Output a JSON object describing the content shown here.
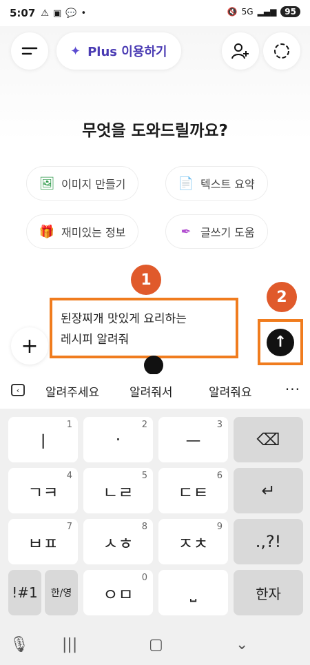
{
  "status": {
    "time": "5:07",
    "icons_left": [
      "warning-icon",
      "image-icon",
      "talk-icon",
      "dot-icon"
    ],
    "signal": "5G",
    "battery": "95"
  },
  "header": {
    "plus_label": "Plus 이용하기"
  },
  "main": {
    "headline": "무엇을 도와드릴까요?",
    "chips": [
      {
        "label": "이미지 만들기",
        "icon": "image-create-icon",
        "color": "#2e9a4a"
      },
      {
        "label": "텍스트 요약",
        "icon": "document-icon",
        "color": "#e8832a"
      },
      {
        "label": "재미있는 정보",
        "icon": "gift-icon",
        "color": "#3aa7c9"
      },
      {
        "label": "글쓰기 도움",
        "icon": "pen-icon",
        "color": "#b24fd0"
      }
    ]
  },
  "annotations": {
    "badge1": "1",
    "badge2": "2"
  },
  "composer": {
    "text_line1": "된장찌개 맛있게 요리하는",
    "text_line2": "레시피 알려줘"
  },
  "suggestions": {
    "words": [
      "알려주세요",
      "알려줘서",
      "알려줘요"
    ],
    "more": "···"
  },
  "keyboard": {
    "row1": [
      {
        "label": "ㅣ",
        "num": "1"
      },
      {
        "label": "·",
        "num": "2"
      },
      {
        "label": "ㅡ",
        "num": "3"
      },
      {
        "label": "⌫",
        "num": ""
      }
    ],
    "row2": [
      {
        "label": "ㄱㅋ",
        "num": "4"
      },
      {
        "label": "ㄴㄹ",
        "num": "5"
      },
      {
        "label": "ㄷㅌ",
        "num": "6"
      },
      {
        "label": "↵",
        "num": ""
      }
    ],
    "row3": [
      {
        "label": "ㅂㅍ",
        "num": "7"
      },
      {
        "label": "ㅅㅎ",
        "num": "8"
      },
      {
        "label": "ㅈㅊ",
        "num": "9"
      },
      {
        "label": ".,?!",
        "num": ""
      }
    ],
    "row4": [
      {
        "label": "!#1",
        "num": ""
      },
      {
        "label": "한/영",
        "num": ""
      },
      {
        "label": "ㅇㅁ",
        "num": "0"
      },
      {
        "label": "⎵",
        "num": ""
      },
      {
        "label": "한자",
        "num": ""
      }
    ]
  },
  "colors": {
    "accent_orange": "#f07c1e",
    "badge_red": "#e05a2b",
    "plus_purple": "#4a3bb3"
  }
}
